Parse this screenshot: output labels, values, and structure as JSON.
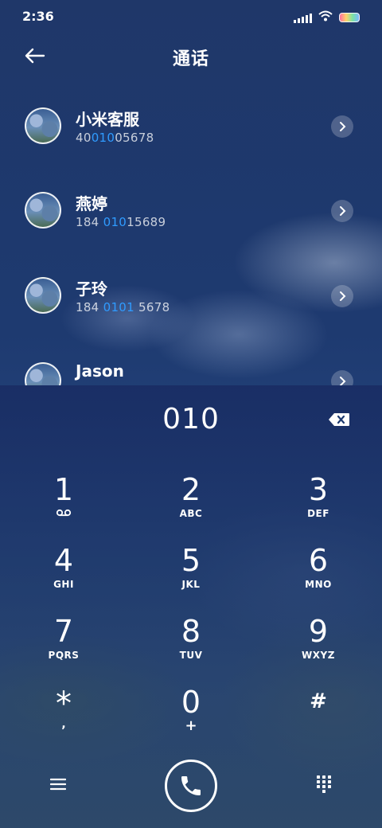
{
  "status_bar": {
    "time": "2:36",
    "icons": [
      "signal-icon",
      "wifi-icon",
      "battery-icon"
    ]
  },
  "header": {
    "title": "通话",
    "back_icon": "back-arrow-icon"
  },
  "contacts": [
    {
      "name": "小米客服",
      "number_parts": [
        "40",
        "010",
        "05678"
      ]
    },
    {
      "name": "燕婷",
      "number_parts": [
        "184 ",
        "010",
        "15689"
      ]
    },
    {
      "name": "子玲",
      "number_parts": [
        "184 ",
        "0101",
        " 5678"
      ]
    },
    {
      "name": "Jason",
      "number_parts": [
        "",
        "",
        ""
      ]
    }
  ],
  "dialer": {
    "input": "010",
    "backspace_icon": "backspace-icon"
  },
  "keys": [
    {
      "digit": "1",
      "sub": "",
      "sub_icon": "voicemail-icon"
    },
    {
      "digit": "2",
      "sub": "ABC"
    },
    {
      "digit": "3",
      "sub": "DEF"
    },
    {
      "digit": "4",
      "sub": "GHI"
    },
    {
      "digit": "5",
      "sub": "JKL"
    },
    {
      "digit": "6",
      "sub": "MNO"
    },
    {
      "digit": "7",
      "sub": "PQRS"
    },
    {
      "digit": "8",
      "sub": "TUV"
    },
    {
      "digit": "9",
      "sub": "WXYZ"
    },
    {
      "digit": "*",
      "sub": ","
    },
    {
      "digit": "0",
      "sub": "+"
    },
    {
      "digit": "#",
      "sub": ""
    }
  ],
  "bottom_bar": {
    "menu_icon": "menu-icon",
    "call_icon": "phone-icon",
    "keypad_icon": "dialpad-icon"
  },
  "colors": {
    "highlight": "#2f9bff",
    "background": "#1c3366"
  }
}
